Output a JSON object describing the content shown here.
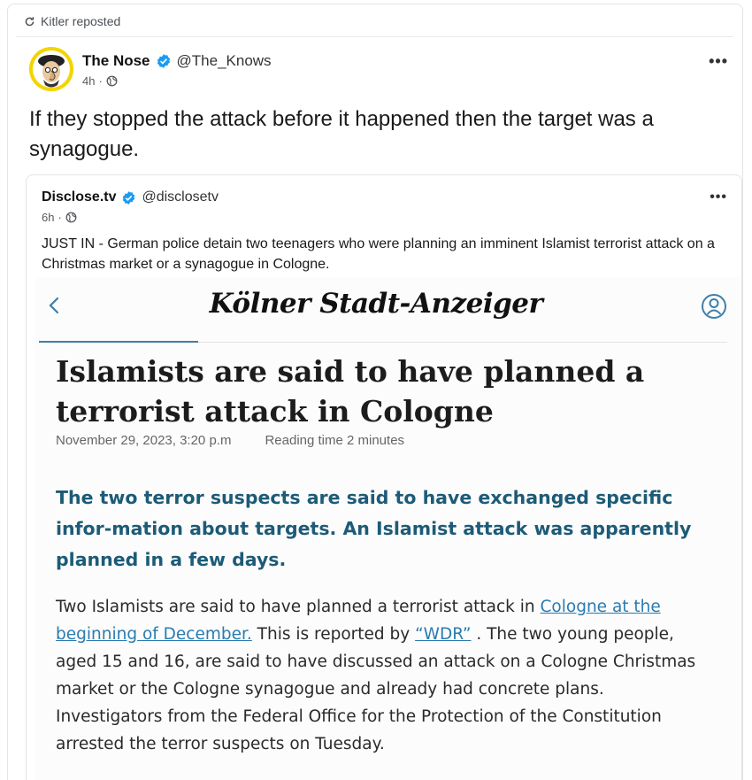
{
  "repost": {
    "label": "Kitler reposted"
  },
  "post": {
    "author": "The Nose",
    "handle": "@The_Knows",
    "time": "4h",
    "more": "•••",
    "text": "If they stopped the attack before it happened then the target was a synagogue."
  },
  "quote": {
    "author": "Disclose.tv",
    "handle": "@disclosetv",
    "time": "6h",
    "more": "•••",
    "text": "JUST IN - German police detain two teenagers who were planning an imminent Islamist terrorist attack on a Christmas market or a synagogue in Cologne."
  },
  "article": {
    "masthead": "Kölner Stadt-Anzeiger",
    "headline": "Islamists are said to have planned a terrorist attack in Cologne",
    "date": "November 29, 2023, 3:20 p.m",
    "reading_time": "Reading time 2 minutes",
    "lead": "The two terror suspects are said to have exchanged specific infor-mation about targets. An Islamist attack was apparently planned in a few days.",
    "body_part1": "Two Islamists are said to have planned a terrorist attack in ",
    "link1": "Cologne at the beginning of December.",
    "body_part2": " This is reported by ",
    "link2": "“WDR”",
    "body_part3": " . The two young people, aged 15 and 16, are said to have discussed an attack on a Cologne Christmas market or the Cologne synagogue and already had concrete plans. Investigators from the Federal Office for the Protection of the Constitution arrested the terror suspects on Tuesday."
  },
  "colors": {
    "verified": "#1d9bf0",
    "lead_text": "#1d5b77",
    "link": "#2a7bb0",
    "avatar_bg": "#f3d400"
  },
  "icons": [
    "repost-icon",
    "verified-icon",
    "globe-icon",
    "more-icon",
    "back-chevron-icon",
    "user-account-icon"
  ]
}
